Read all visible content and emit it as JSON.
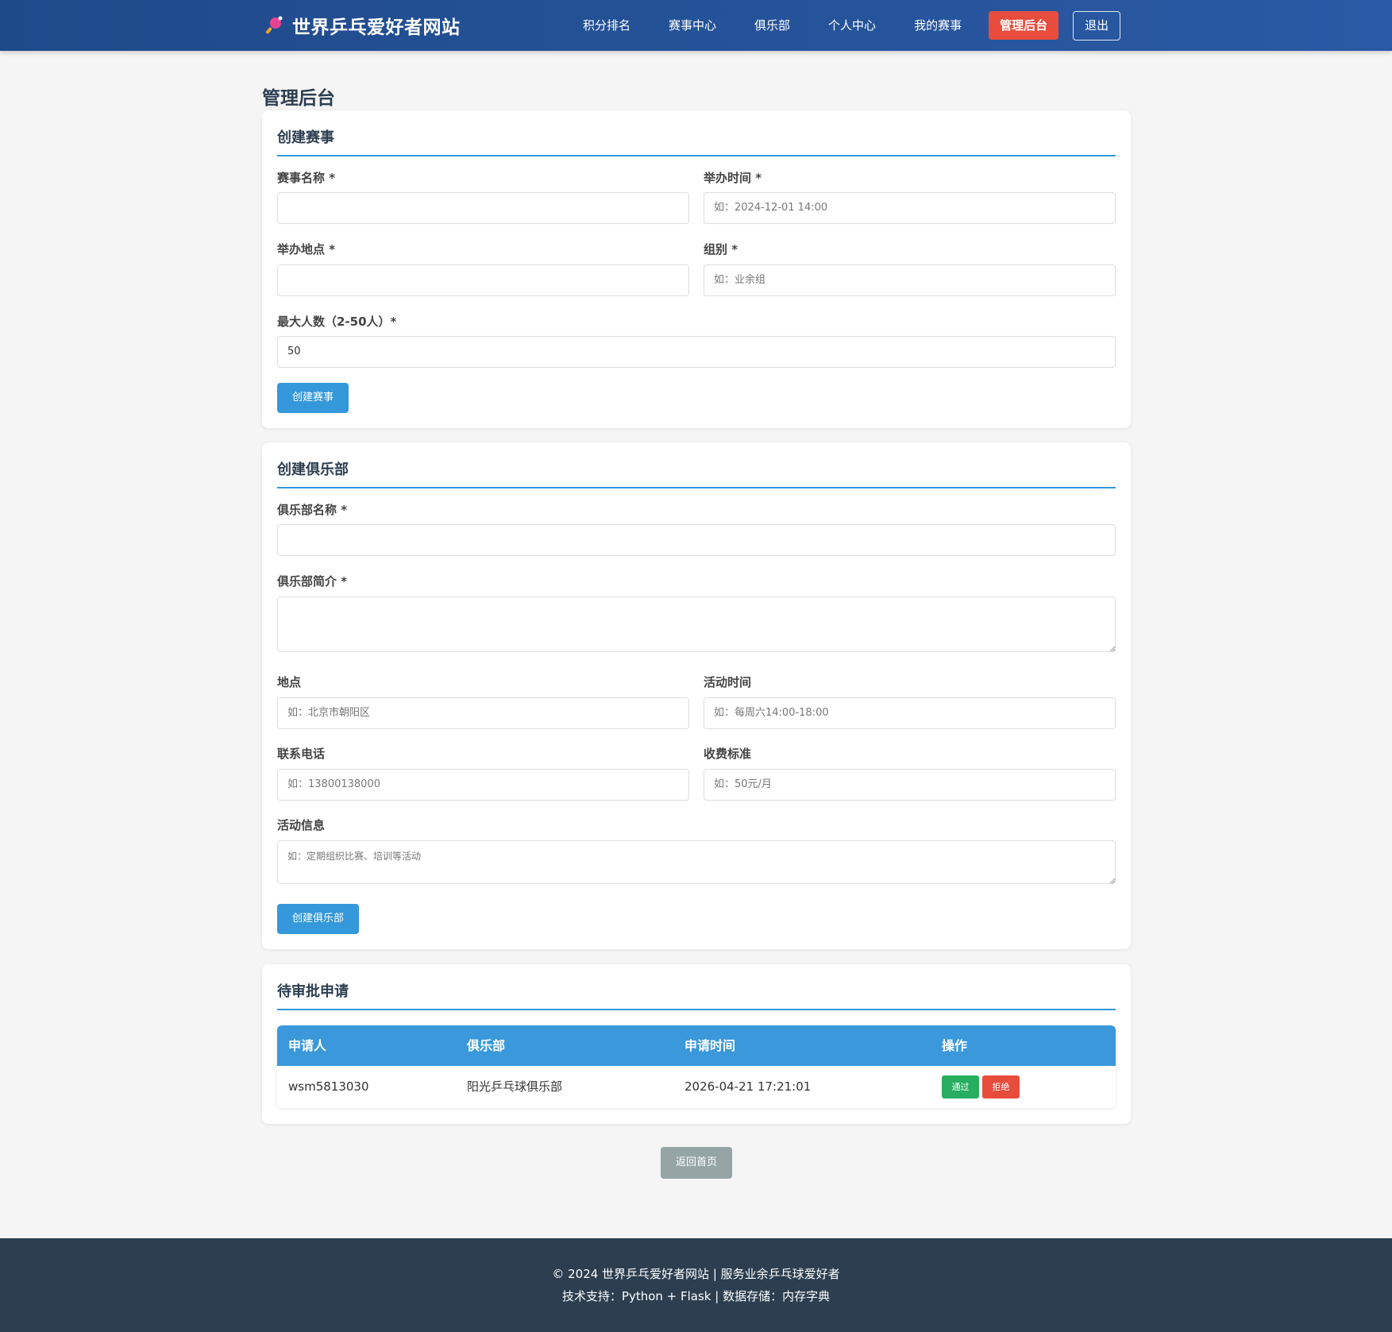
{
  "header": {
    "site_title": "世界乒乓爱好者网站",
    "nav": [
      {
        "label": "积分排名"
      },
      {
        "label": "赛事中心"
      },
      {
        "label": "俱乐部"
      },
      {
        "label": "个人中心"
      },
      {
        "label": "我的赛事"
      },
      {
        "label": "管理后台"
      },
      {
        "label": "退出"
      }
    ]
  },
  "page_title": "管理后台",
  "create_event": {
    "title": "创建赛事",
    "name_label": "赛事名称 *",
    "name_value": "",
    "time_label": "举办时间 *",
    "time_placeholder": "如：2024-12-01 14:00",
    "location_label": "举办地点 *",
    "location_value": "",
    "group_label": "组别 *",
    "group_placeholder": "如：业余组",
    "max_label": "最大人数（2-50人）*",
    "max_value": "50",
    "submit_label": "创建赛事"
  },
  "create_club": {
    "title": "创建俱乐部",
    "name_label": "俱乐部名称 *",
    "name_value": "",
    "intro_label": "俱乐部简介 *",
    "intro_value": "",
    "location_label": "地点",
    "location_placeholder": "如：北京市朝阳区",
    "activity_time_label": "活动时间",
    "activity_time_placeholder": "如：每周六14:00-18:00",
    "phone_label": "联系电话",
    "phone_placeholder": "如：13800138000",
    "fee_label": "收费标准",
    "fee_placeholder": "如：50元/月",
    "info_label": "活动信息",
    "info_placeholder": "如：定期组织比赛、培训等活动",
    "submit_label": "创建俱乐部"
  },
  "pending": {
    "title": "待审批申请",
    "columns": [
      "申请人",
      "俱乐部",
      "申请时间",
      "操作"
    ],
    "rows": [
      {
        "applicant": "wsm5813030",
        "club": "阳光乒乓球俱乐部",
        "time": "2026-04-21 17:21:01",
        "approve": "通过",
        "reject": "拒绝"
      }
    ]
  },
  "back_label": "返回首页",
  "footer": {
    "line1": "© 2024 世界乒乓爱好者网站 | 服务业余乒乓球爱好者",
    "line2": "技术支持：Python + Flask | 数据存储：内存字典"
  },
  "colors": {
    "header": "#2a5aa5",
    "primary": "#3498db",
    "danger": "#e74c3c",
    "success": "#27ae60",
    "footer": "#2c3e50",
    "secondary": "#95a5a6"
  },
  "icons": {
    "brand": "ping-pong-paddle-icon"
  }
}
